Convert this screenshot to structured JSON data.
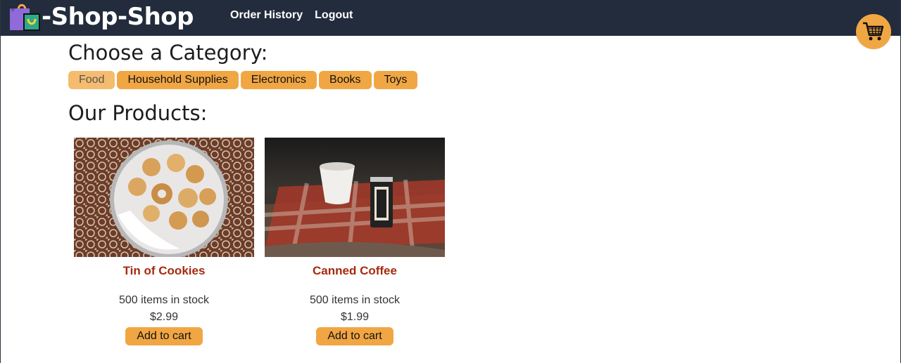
{
  "header": {
    "brand": "-Shop-Shop",
    "nav": [
      {
        "label": "Order History"
      },
      {
        "label": "Logout"
      }
    ]
  },
  "cart": {
    "icon": "shopping-cart-icon"
  },
  "categories": {
    "title": "Choose a Category:",
    "items": [
      "Food",
      "Household Supplies",
      "Electronics",
      "Books",
      "Toys"
    ],
    "selected": "Food"
  },
  "products": {
    "title": "Our Products:",
    "items": [
      {
        "name": "Tin of Cookies",
        "stock": "500 items in stock",
        "price": "$2.99",
        "button": "Add to cart"
      },
      {
        "name": "Canned Coffee",
        "stock": "500 items in stock",
        "price": "$1.99",
        "button": "Add to cart"
      }
    ]
  },
  "colors": {
    "navbar": "#222c3c",
    "accent": "#f1a644",
    "product_name": "#a52a0e"
  }
}
